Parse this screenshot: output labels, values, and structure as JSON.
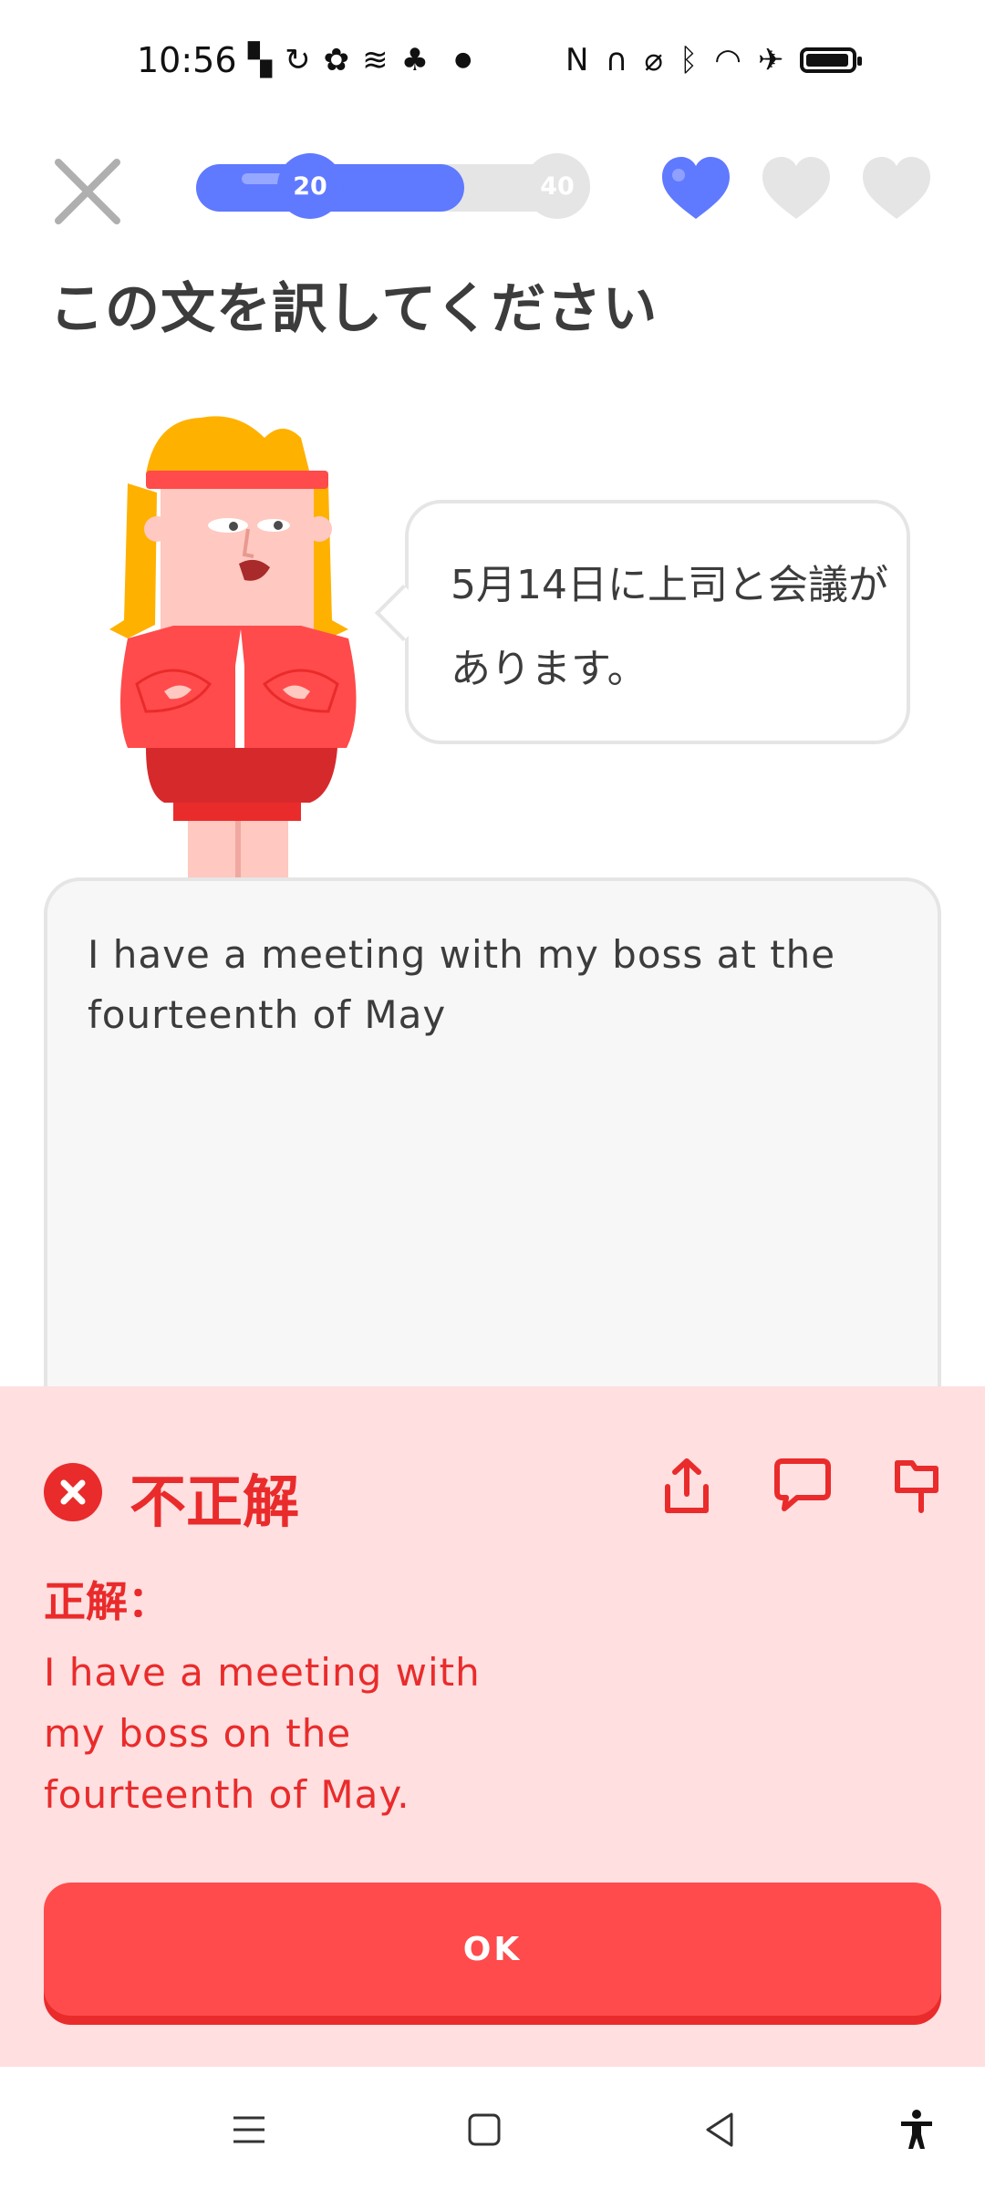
{
  "status_bar": {
    "time": "10:56",
    "icons_left": [
      "app-notification-icon",
      "sync-icon",
      "app-icon",
      "signal-app-icon",
      "leaf-icon",
      "dot-icon"
    ],
    "icons_right": [
      "nfc-icon",
      "headphones-icon",
      "mute-icon",
      "bluetooth-icon",
      "wifi-icon",
      "airplane-icon",
      "battery-icon"
    ]
  },
  "header": {
    "progress_fraction": 0.68,
    "milestones": [
      {
        "label": "20",
        "reached": true
      },
      {
        "label": "40",
        "reached": false
      }
    ],
    "hearts": {
      "filled": 1,
      "total": 3
    },
    "colors": {
      "progress": "#5f79ff",
      "track": "#e5e5e5"
    }
  },
  "prompt": {
    "title": "この文を訳してください",
    "sentence": "5月14日に上司と会議があります。"
  },
  "answer": {
    "value": "I have a meeting with my boss at the fourteenth of May"
  },
  "feedback": {
    "status": "不正解",
    "label": "正解：",
    "correct_answer": "I have a meeting with my boss on the fourteenth of May.",
    "actions": [
      "share-icon",
      "comment-icon",
      "flag-icon"
    ],
    "button_label": "OK",
    "colors": {
      "background": "#ffdfe0",
      "accent": "#ea2b2b",
      "button": "#ff4b4b"
    }
  },
  "nav_bar": {
    "buttons": [
      "menu-icon",
      "home-icon",
      "back-icon",
      "accessibility-icon"
    ]
  }
}
